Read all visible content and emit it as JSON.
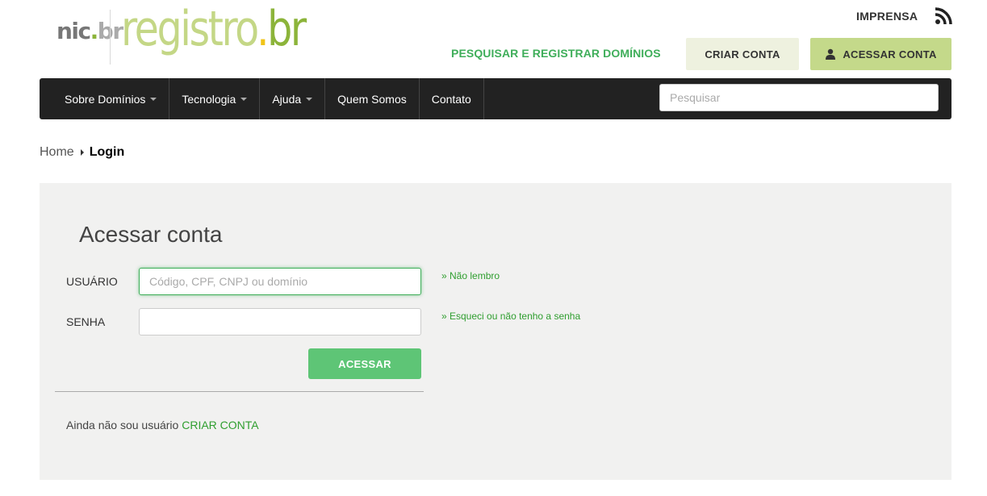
{
  "logo": {
    "nic_text": "nic",
    "nic_dot": ".",
    "nic_br": "br",
    "registro_text": "registro",
    "registro_dot": ".",
    "registro_br": "br"
  },
  "header": {
    "imprensa": "IMPRENSA",
    "rss_icon": "rss-icon",
    "pesquisar_link": "PESQUISAR E REGISTRAR DOMÍNIOS",
    "criar_conta": "CRIAR CONTA",
    "acessar_conta": "ACESSAR CONTA",
    "user_icon": "user-icon"
  },
  "nav": {
    "items": [
      {
        "label": "Sobre Domínios",
        "dropdown": true
      },
      {
        "label": "Tecnologia",
        "dropdown": true
      },
      {
        "label": "Ajuda",
        "dropdown": true
      },
      {
        "label": "Quem Somos",
        "dropdown": false
      },
      {
        "label": "Contato",
        "dropdown": false
      }
    ],
    "search_placeholder": "Pesquisar"
  },
  "breadcrumb": {
    "home": "Home",
    "current": "Login"
  },
  "login": {
    "title": "Acessar conta",
    "user_label": "USUÁRIO",
    "user_placeholder": "Código, CPF, CNPJ ou domínio",
    "user_value": "",
    "forgot_user": "» Não lembro",
    "password_label": "SENHA",
    "password_value": "",
    "forgot_password": "» Esqueci ou não tenho a senha",
    "submit": "ACESSAR",
    "signup_text": "Ainda não sou usuário",
    "signup_link": "CRIAR CONTA"
  },
  "colors": {
    "accent_green": "#3fae5a",
    "logo_light_green": "#c4d786",
    "logo_green": "#8cb43a",
    "navbar_bg": "#222222",
    "panel_bg": "#f1f1f0",
    "submit_bg": "#5ec576"
  }
}
